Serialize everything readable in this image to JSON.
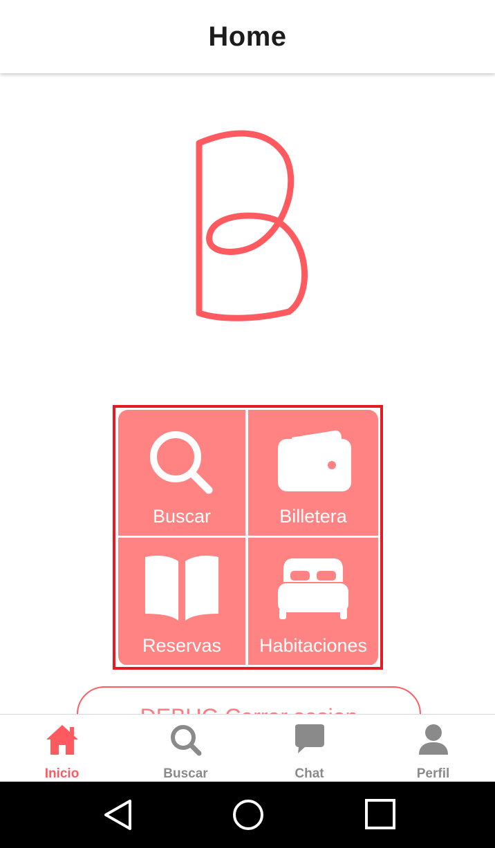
{
  "header": {
    "title": "Home"
  },
  "colors": {
    "brand": "#ff5a5f",
    "tile": "#ff8383",
    "highlight_frame": "#e21b25",
    "inactive_nav": "#8a8a8a"
  },
  "logo": {
    "icon": "b-logo-icon"
  },
  "menu": {
    "tiles": [
      {
        "label": "Buscar",
        "icon": "search-icon"
      },
      {
        "label": "Billetera",
        "icon": "wallet-icon"
      },
      {
        "label": "Reservas",
        "icon": "open-book-icon"
      },
      {
        "label": "Habitaciones",
        "icon": "bed-icon"
      }
    ]
  },
  "debug_button": {
    "label": "DEBUG Cerrar sesion"
  },
  "bottom_nav": {
    "active": "Inicio",
    "items": [
      {
        "label": "Inicio",
        "icon": "home-icon"
      },
      {
        "label": "Buscar",
        "icon": "search-icon"
      },
      {
        "label": "Chat",
        "icon": "chat-icon"
      },
      {
        "label": "Perfil",
        "icon": "person-icon"
      }
    ]
  },
  "system_nav": {
    "buttons": [
      "back-icon",
      "home-circle-icon",
      "recents-icon"
    ]
  }
}
